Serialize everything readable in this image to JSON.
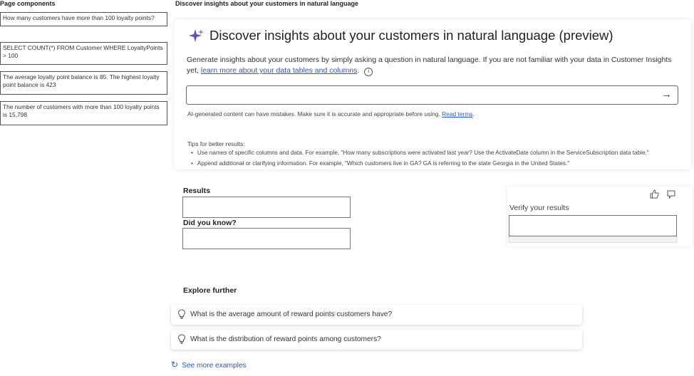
{
  "left_panel": {
    "title": "Page components",
    "items": [
      "How many customers have more than 100 loyalty points?",
      "SELECT COUNT(*) FROM Customer WHERE LoyaltyPoints > 100",
      "The average loyalty point balance is 85. The highest loyalty point balance is 423",
      "The number of customers with more than 100 loyalty points is 15,798"
    ]
  },
  "page_heading": "Discover insights about your customers in natural language",
  "card": {
    "title": "Discover insights about your customers in natural language (preview)",
    "intro": "Generate insights about your customers by simply asking a question in natural language. If you are not familiar with your data in Customer Insights yet,",
    "intro_link": "learn more about your data tables and columns",
    "intro_suffix": ".",
    "info_icon": "i",
    "query_value": "",
    "send_icon": "→",
    "disclaimer": "AI-generated content can have mistakes. Make sure it is accurate and appropriate before using.",
    "disclaimer_link": "Read terms",
    "disclaimer_suffix": ".",
    "tips_title": "Tips for better results:",
    "tips": [
      "Use names of specific columns and data. For example, \"How many subscriptions were activated last year? Use the ActivateDate column in the ServiceSubscription data table.\"",
      "Append additional or clarifying information. For example, \"Which customers live in GA? GA is referring to the state Georgia in the United States.\""
    ]
  },
  "results": {
    "results_label": "Results",
    "did_you_know_label": "Did you know?",
    "verify_label": "Verify your results"
  },
  "explore": {
    "title": "Explore further",
    "suggestions": [
      "What is the average amount of reward points customers have?",
      "What is the distribution of reward points among customers?"
    ],
    "see_more": "See more examples"
  },
  "colors": {
    "accent": "#5b4fd6",
    "link": "#2b58c2"
  },
  "icons": {
    "sparkle": "sparkle-icon",
    "info": "info-icon",
    "send": "arrow-right-icon",
    "thumbs_up": "thumbs-up-icon",
    "thumbs_down": "thumbs-down-icon",
    "bulb": "lightbulb-icon",
    "refresh": "refresh-icon"
  }
}
